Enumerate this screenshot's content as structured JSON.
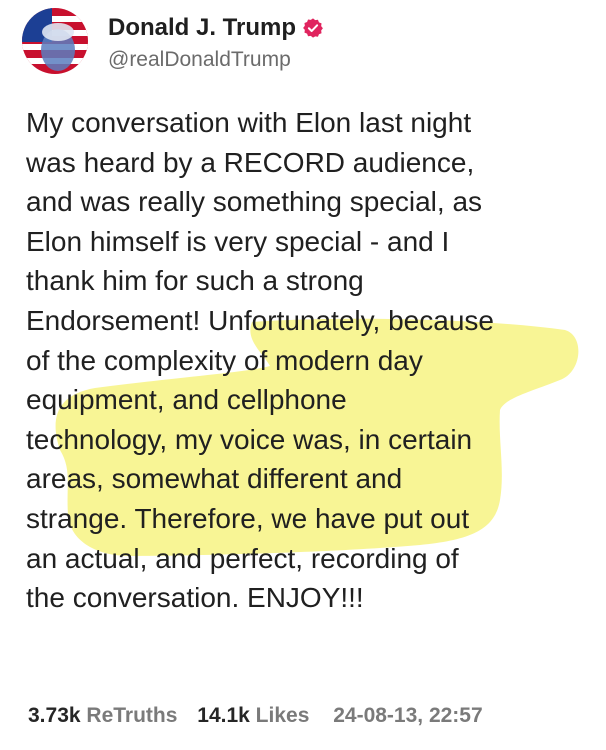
{
  "author": {
    "display_name": "Donald J. Trump",
    "handle": "@realDonaldTrump",
    "verified_color": "#e0245e"
  },
  "post": {
    "lines": [
      "My conversation with Elon last night",
      "was heard by a RECORD audience,",
      "and was really something special, as",
      "Elon himself is very special - and I",
      "thank him for such a strong",
      "Endorsement! Unfortunately, because",
      "of the complexity of modern day",
      "equipment, and cellphone",
      "technology, my voice was, in certain",
      "areas, somewhat different and",
      "strange. Therefore, we have put out",
      "an actual, and perfect, recording of",
      "the conversation. ENJOY!!!"
    ],
    "highlight_color": "#f6f27a"
  },
  "stats": {
    "retruths_count": "3.73k",
    "retruths_label": "ReTruths",
    "likes_count": "14.1k",
    "likes_label": "Likes",
    "timestamp": "24-08-13, 22:57"
  }
}
